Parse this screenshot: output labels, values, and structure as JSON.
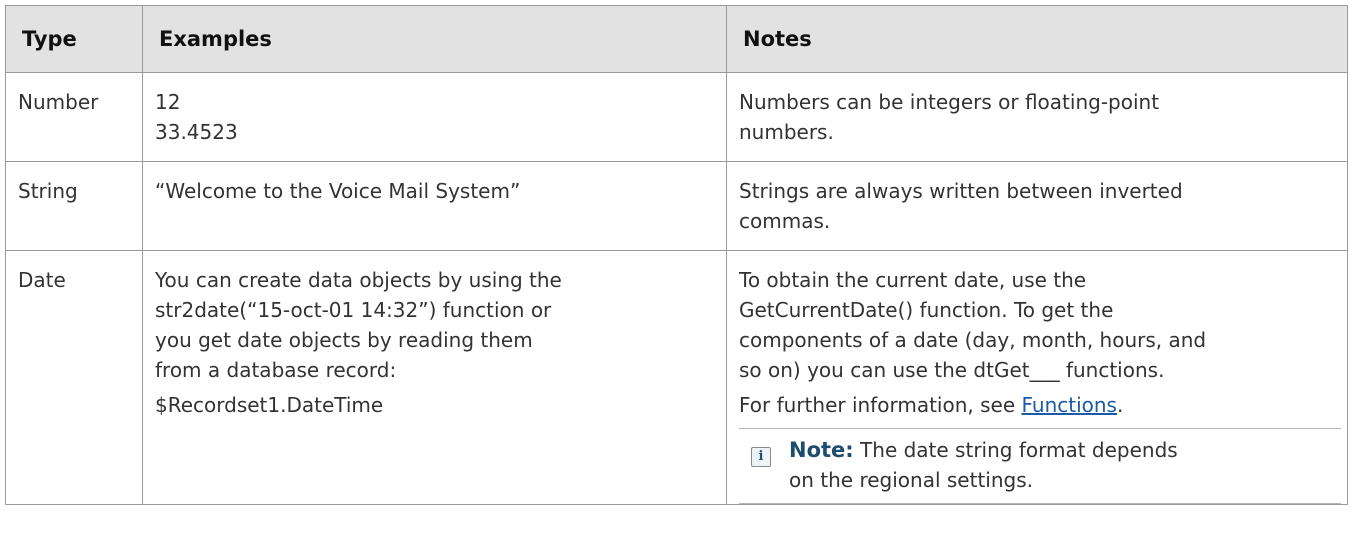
{
  "table": {
    "headers": {
      "type": "Type",
      "examples": "Examples",
      "notes": "Notes"
    },
    "rows": [
      {
        "type": "Number",
        "examples": [
          "12",
          "33.4523"
        ],
        "notes": [
          "Numbers can be integers or floating-point",
          "numbers."
        ]
      },
      {
        "type": "String",
        "examples": [
          "“Welcome to the Voice Mail System”"
        ],
        "notes": [
          "Strings are always written between inverted",
          "commas."
        ]
      },
      {
        "type": "Date",
        "examples": [
          "You can create data objects by using the",
          "str2date(“15-oct-01 14:32”) function or",
          "you get date objects by reading them",
          "from a database record:",
          "$Recordset1.DateTime"
        ],
        "notes": [
          "To obtain the current date, use the",
          "GetCurrentDate() function. To get the",
          "components of a date (day, month, hours, and",
          "so on) you can use the dtGet___ functions."
        ],
        "further_info_prefix": "For further information, see ",
        "further_info_link": "Functions",
        "further_info_suffix": ".",
        "note": {
          "icon": "info-icon",
          "label": "Note:",
          "lines": [
            " The date string format depends",
            "on the regional settings."
          ]
        }
      }
    ]
  }
}
